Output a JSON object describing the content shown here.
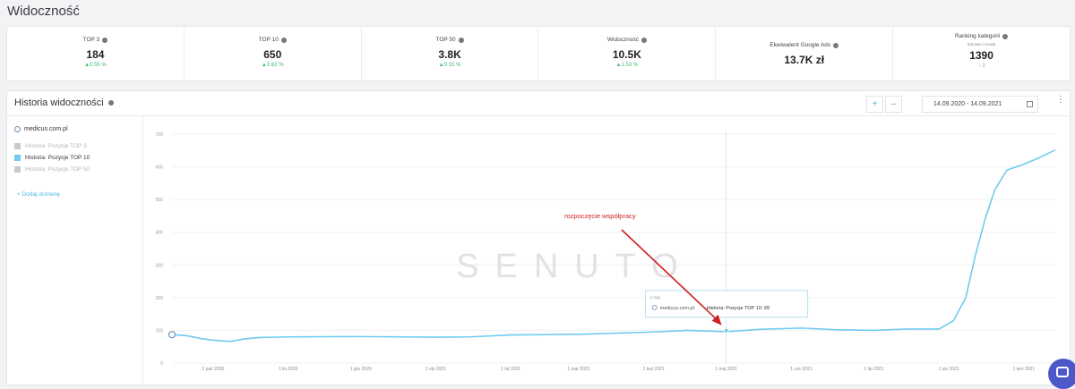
{
  "page": {
    "title": "Widoczność"
  },
  "kpis": [
    {
      "label": "TOP 3",
      "value": "184",
      "change": "▲0.55 %"
    },
    {
      "label": "TOP 10",
      "value": "650",
      "change": "▲0.62 %"
    },
    {
      "label": "TOP 50",
      "value": "3.8K",
      "change": "▲0.15 %"
    },
    {
      "label": "Widoczność",
      "value": "10.5K",
      "change": "▲1.53 %"
    },
    {
      "label": "Ekwiwalent Google Ads",
      "value": "13.7K zł"
    },
    {
      "label": "Ranking kategorii",
      "sub": "Zdrowie i Uroda",
      "value": "1390",
      "change": "↑ 3"
    }
  ],
  "panel": {
    "title": "Historia widoczności",
    "zoom_in": "+",
    "zoom_out": "–",
    "date_range": "14.09.2020 - 14.09.2021",
    "menu": "⋮"
  },
  "legend": {
    "domain": "medicus.com.pl",
    "items": [
      {
        "label": "Historia: Pozycje TOP 3",
        "active": false
      },
      {
        "label": "Historia: Pozycje TOP 10",
        "active": true
      },
      {
        "label": "Historia: Pozycje TOP 50",
        "active": false
      }
    ],
    "add_domain": "+ Dodaj domenę"
  },
  "colors": {
    "series": "#6fcbef",
    "accent": "#4cb7e8",
    "annotation": "#d02020",
    "inactive": "#b5b5bd"
  },
  "chart_data": {
    "type": "line",
    "y_ticks": [
      "0",
      "100",
      "200",
      "300",
      "400",
      "500",
      "600",
      "700"
    ],
    "ylim": [
      0,
      700
    ],
    "x_ticks": [
      "1 paź 2020",
      "1 lis 2020",
      "1 gru 2020",
      "1 sty 2021",
      "1 lut 2021",
      "1 mar 2021",
      "1 kwi 2021",
      "1 maj 2021",
      "1 cze 2021",
      "1 lip 2021",
      "1 sie 2021",
      "1 wrz 2021"
    ],
    "series": [
      {
        "name": "Historia: Pozycje TOP 10",
        "points": [
          [
            "14.09.2020",
            87
          ],
          [
            "20.09.2020",
            84
          ],
          [
            "26.09.2020",
            75
          ],
          [
            "1.10.2020",
            70
          ],
          [
            "8.10.2020",
            66
          ],
          [
            "14.10.2020",
            74
          ],
          [
            "20.10.2020",
            78
          ],
          [
            "1.11.2020",
            80
          ],
          [
            "1.12.2020",
            81
          ],
          [
            "1.01.2021",
            79
          ],
          [
            "15.01.2021",
            80
          ],
          [
            "1.02.2021",
            86
          ],
          [
            "1.03.2021",
            88
          ],
          [
            "1.04.2021",
            95
          ],
          [
            "15.04.2021",
            100
          ],
          [
            "1.05.2021",
            96
          ],
          [
            "15.05.2021",
            103
          ],
          [
            "1.06.2021",
            107
          ],
          [
            "15.06.2021",
            102
          ],
          [
            "1.07.2021",
            100
          ],
          [
            "15.07.2021",
            104
          ],
          [
            "28.07.2021",
            104
          ],
          [
            "3.08.2021",
            130
          ],
          [
            "8.08.2021",
            200
          ],
          [
            "12.08.2021",
            330
          ],
          [
            "16.08.2021",
            440
          ],
          [
            "20.08.2021",
            530
          ],
          [
            "25.08.2021",
            590
          ],
          [
            "1.09.2021",
            608
          ],
          [
            "8.09.2021",
            630
          ],
          [
            "14.09.2021",
            652
          ]
        ]
      }
    ],
    "crosshair_x": "1 maj 2021",
    "marker_start": 87
  },
  "tooltip": {
    "date": "1 maj",
    "domain": "medicus.com.pl",
    "text": "Historia: Pozycje TOP 10: 99"
  },
  "annotation": {
    "text": "rozpoczęcie współpracy"
  },
  "watermark": "SENUTO"
}
